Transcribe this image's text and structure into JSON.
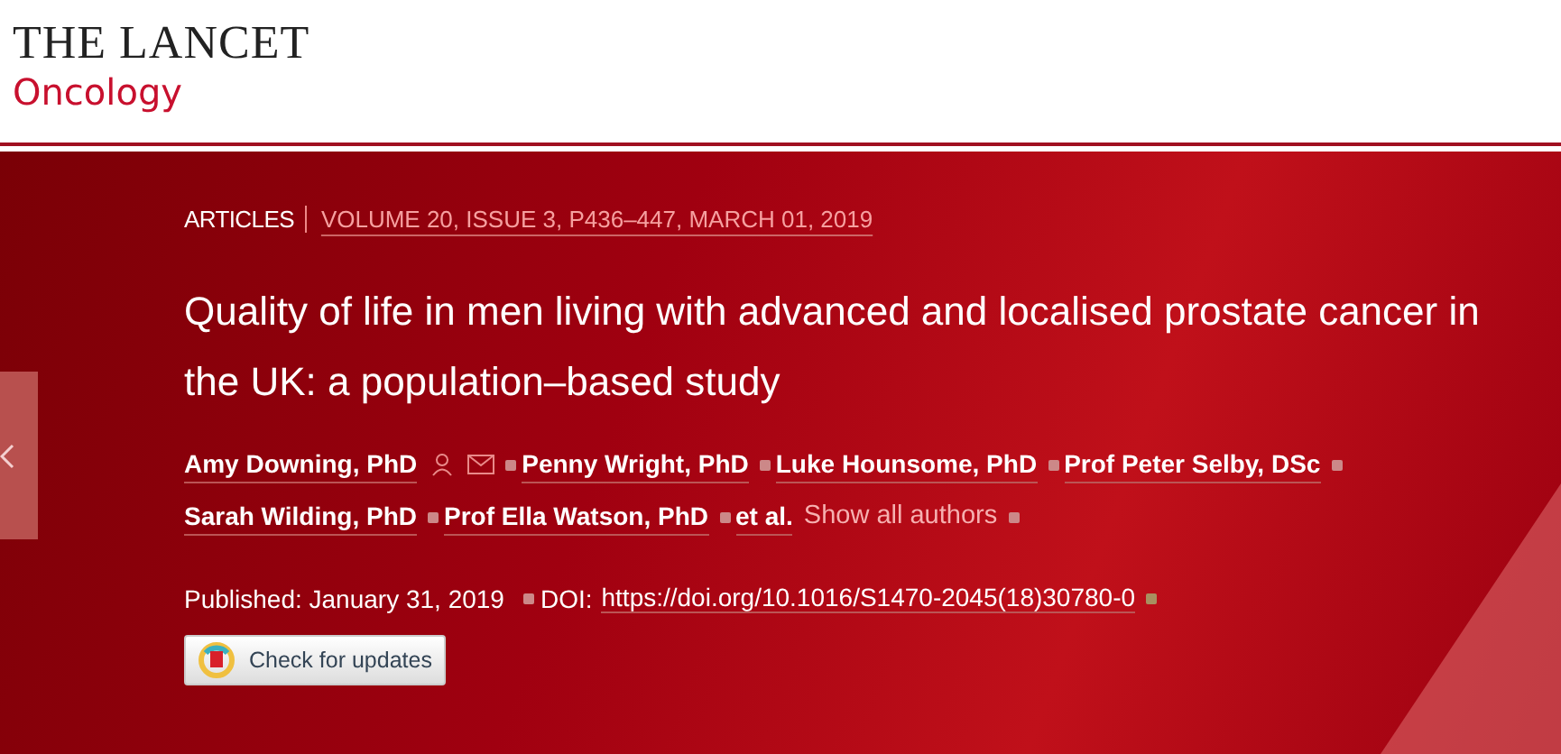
{
  "journal": {
    "name": "THE LANCET",
    "section": "Oncology"
  },
  "article": {
    "type": "ARTICLES",
    "citation": "VOLUME 20, ISSUE 3, P436–447, MARCH 01, 2019",
    "title": "Quality of life in men living with advanced and localised prostate cancer in the UK: a population–based study",
    "authors": [
      {
        "name": "Amy Downing, PhD",
        "contact_icons": true
      },
      {
        "name": "Penny Wright, PhD",
        "contact_icons": false
      },
      {
        "name": "Luke Hounsome, PhD",
        "contact_icons": false
      },
      {
        "name": "Prof Peter Selby, DSc",
        "contact_icons": false
      },
      {
        "name": "Sarah Wilding, PhD",
        "contact_icons": false
      },
      {
        "name": "Prof Ella Watson, PhD",
        "contact_icons": false
      }
    ],
    "et_al": "et al.",
    "show_all": "Show all authors",
    "published": "Published: January 31, 2019",
    "doi_label": "DOI:",
    "doi": "https://doi.org/10.1016/S1470-2045(18)30780-0",
    "check_updates": "Check for updates"
  }
}
